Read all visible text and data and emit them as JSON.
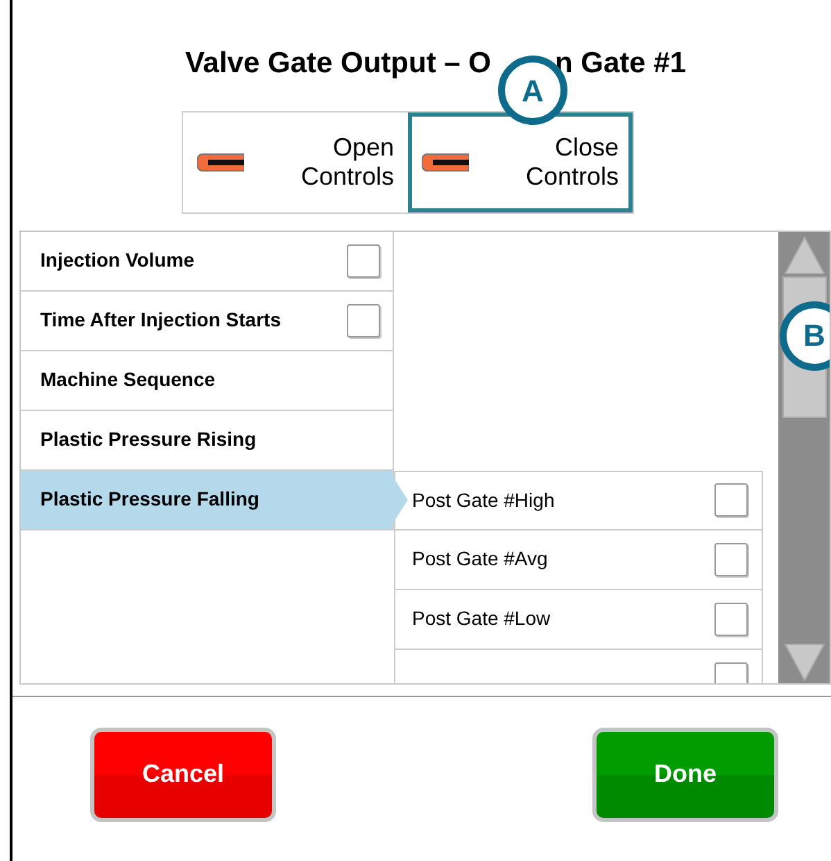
{
  "title": {
    "start": "Valve Gate Output – O",
    "end": "n Gate #1"
  },
  "toggle": [
    {
      "label": "Open\nControls",
      "selected": false
    },
    {
      "label": "Close\nControls",
      "selected": true
    }
  ],
  "menu": [
    {
      "label": "Injection Volume",
      "kind": "checkbox",
      "checked": false,
      "selected": false
    },
    {
      "label": "Time After Injection Starts",
      "kind": "checkbox",
      "checked": false,
      "selected": false
    },
    {
      "label": "Machine Sequence",
      "kind": "submenu",
      "selected": false
    },
    {
      "label": "Plastic Pressure Rising",
      "kind": "submenu",
      "selected": false
    },
    {
      "label": "Plastic Pressure Falling",
      "kind": "submenu",
      "selected": true
    }
  ],
  "submenu": [
    {
      "label": "Post Gate #High",
      "checked": false
    },
    {
      "label": "Post Gate #Avg",
      "checked": false
    },
    {
      "label": "Post Gate #Low",
      "checked": false
    },
    {
      "checked": false
    }
  ],
  "buttons": [
    {
      "label": "Cancel",
      "kind": "cancel"
    },
    {
      "label": "Done",
      "kind": "done"
    }
  ],
  "callouts": [
    {
      "label": "A"
    },
    {
      "label": "B"
    }
  ]
}
